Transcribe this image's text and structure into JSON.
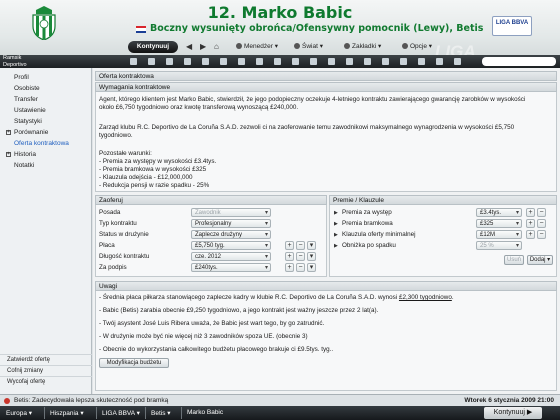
{
  "colors": {
    "accent_green": "#0f7a2f",
    "link_blue": "#1f5fbf",
    "toolbar_dark": "#1c2023"
  },
  "header": {
    "player_name": "12. Marko Babic",
    "position": "Boczny wysunięty obrońca/Ofensywny pomocnik (Lewy), Betis",
    "league_logo": "LIGA BBVA",
    "watermark": "LIGA"
  },
  "nav": {
    "continue": "Kontynuuj",
    "back_icon": "arrow-left-icon",
    "forward_icon": "arrow-right-icon",
    "home_icon": "home-icon",
    "manager": "Menedżer",
    "world": "Świat",
    "bookmarks": "Zakładki",
    "options": "Opcje"
  },
  "toolbar": {
    "club_short_1": "Ramsik",
    "club_short_2": "Deportivo"
  },
  "sidebar": {
    "items": [
      {
        "label": "Profil",
        "expandable": false
      },
      {
        "label": "Osobiste",
        "expandable": false
      },
      {
        "label": "Transfer",
        "expandable": false
      },
      {
        "label": "Ustawienie",
        "expandable": false
      },
      {
        "label": "Statystyki",
        "expandable": false
      },
      {
        "label": "Porównanie",
        "expandable": true
      },
      {
        "label": "Oferta kontraktowa",
        "expandable": false,
        "active": true
      },
      {
        "label": "Historia",
        "expandable": true
      },
      {
        "label": "Notatki",
        "expandable": false
      }
    ],
    "actions": [
      "Zatwierdź ofertę",
      "Cofnij zmiany",
      "Wycofaj ofertę"
    ]
  },
  "main": {
    "title": "Oferta kontraktowa",
    "requirements": {
      "title": "Wymagania kontraktowe",
      "para1_line1": "Agent, którego klientem jest Marko Babic, stwierdził, że jego podopieczny oczekuje 4-letniego kontraktu zawierającego gwarancję zarobków w wysokości",
      "para1_line2": "około £6,750 tygodniowo oraz kwotę transferową wynoszącą £240,000.",
      "para2_line1": "Zarząd klubu R.C. Deportivo de La Coruña S.A.D. zezwoli ci na zaoferowanie temu zawodnikowi maksymalnego wynagrodzenia w wysokości £5,750",
      "para2_line2": "tygodniowo.",
      "remaining_title": "Pozostałe warunki:",
      "conditions": [
        "- Premia za występy w wysokości £3.4tys.",
        "- Premia bramkowa w wysokości £325",
        "- Klauzula odejścia - £12,000,000",
        "- Redukcja pensji w razie spadku - 25%"
      ]
    },
    "offer": {
      "title": "Zaoferuj",
      "fields": [
        {
          "label": "Posada",
          "value": "Zawodnik",
          "disabled": true
        },
        {
          "label": "Typ kontraktu",
          "value": "Profesjonalny",
          "disabled": false
        },
        {
          "label": "Status w drużynie",
          "value": "Zaplecze drużyny",
          "disabled": false
        },
        {
          "label": "Płaca",
          "value": "£5,750 tyg.",
          "disabled": false
        },
        {
          "label": "Długość kontraktu",
          "value": "cze. 2012",
          "disabled": false
        },
        {
          "label": "Za podpis",
          "value": "£240tys.",
          "disabled": false
        }
      ]
    },
    "bonuses": {
      "title": "Premie / Klauzule",
      "items": [
        {
          "label": "Premia za występ",
          "value": "£3.4tys.",
          "disabled": false
        },
        {
          "label": "Premia bramkowa",
          "value": "£325",
          "disabled": false
        },
        {
          "label": "Klauzula oferty minimalnej",
          "value": "£12M",
          "disabled": false
        },
        {
          "label": "Obniżka po spadku",
          "value": "25 %",
          "disabled": true
        }
      ],
      "remove": "Usuń",
      "add": "Dodaj"
    },
    "notes": {
      "title": "Uwagi",
      "line1_prefix": "- Średnia płaca piłkarza stanowiącego zaplecze kadry w klubie R.C. Deportivo de La Coruña S.A.D. wynosi ",
      "line1_link": "£2,300 tygodniowo",
      "line1_suffix": ".",
      "lines": [
        "- Babic (Betis) zarabia obecnie £9,250 tygodniowo, a jego kontrakt jest ważny jeszcze przez 2 lat(a).",
        "- Twój asystent José Luis Ribera uważa, że Babic jest wart tego, by go zatrudnić.",
        "- W drużynie może być nie więcej niż 3 zawodników spoza UE. (obecnie 3)",
        "- Obecnie do wykorzystania całkowitego budżetu płacowego brakuje ci £9.5tys. tyg.."
      ],
      "budget_button": "Modyfikacja budżetu"
    }
  },
  "status": {
    "news": "Betis: Zadecydowała lepsza skuteczność pod bramką",
    "date": "Wtorek 6 stycznia 2009 21:00"
  },
  "bottom": {
    "crumbs": [
      "Europa",
      "Hiszpania",
      "LIGA BBVA",
      "Betis",
      "Marko Babic"
    ],
    "continue": "Kontynuuj"
  }
}
